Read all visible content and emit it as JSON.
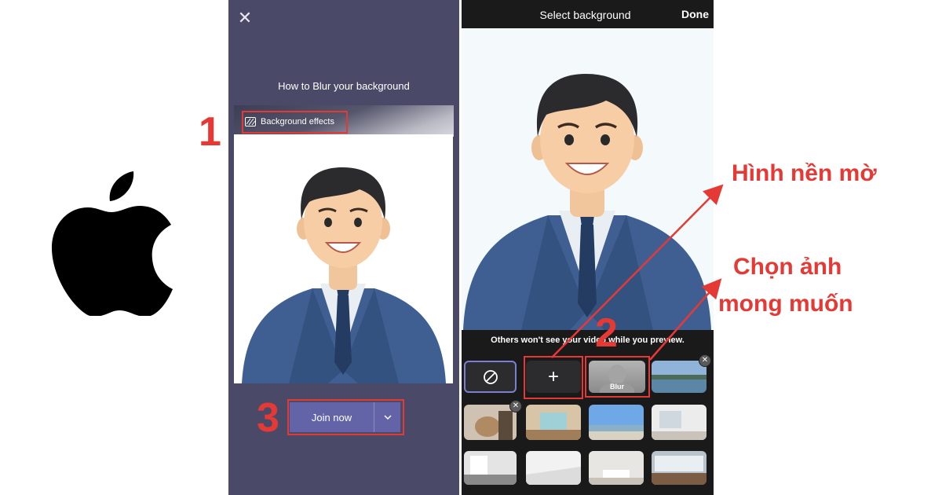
{
  "left_screen": {
    "title": "How to Blur your background",
    "background_effects_label": "Background effects",
    "join_label": "Join now"
  },
  "right_screen": {
    "title": "Select background",
    "done_label": "Done",
    "preview_note": "Others won't see your video while you preview.",
    "blur_label": "Blur"
  },
  "steps": {
    "one": "1",
    "two": "2",
    "three": "3"
  },
  "annotations": {
    "blur_background": "Hình nền mờ",
    "choose_image_line1": "Chọn ảnh",
    "choose_image_line2": "mong muốn"
  },
  "colors": {
    "accent": "#6264a7",
    "highlight": "#e53935",
    "left_bg": "#4a4a68",
    "right_bg": "#1a1a1a"
  }
}
